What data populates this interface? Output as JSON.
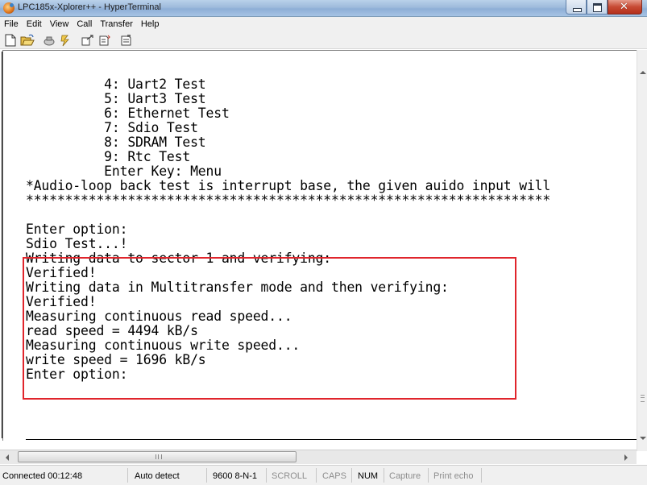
{
  "window": {
    "title": "LPC185x-Xplorer++ - HyperTerminal"
  },
  "menu": [
    "File",
    "Edit",
    "View",
    "Call",
    "Transfer",
    "Help"
  ],
  "toolbar": {
    "icons": [
      "new-icon",
      "open-icon",
      "call-icon",
      "hang-up-icon",
      "send-icon",
      "receive-icon",
      "properties-icon"
    ]
  },
  "terminal": {
    "lines": [
      "          4: Uart2 Test",
      "          5: Uart3 Test",
      "          6: Ethernet Test",
      "          7: Sdio Test",
      "          8: SDRAM Test",
      "          9: Rtc Test",
      "          Enter Key: Menu",
      "*Audio-loop back test is interrupt base, the given auido input will",
      "*******************************************************************",
      "",
      "Enter option:",
      "Sdio Test...!",
      "Writing data to sector 1 and verifying:",
      "Verified!",
      "Writing data in Multitransfer mode and then verifying:",
      "Verified!",
      "Measuring continuous read speed...",
      "read speed = 4494 kB/s",
      "Measuring continuous write speed...",
      "write speed = 1696 kB/s",
      "Enter option:"
    ],
    "highlight_color": "#e0252c"
  },
  "statusbar": {
    "connected": "Connected 00:12:48",
    "detect": "Auto detect",
    "settings": "9600 8-N-1",
    "scroll": "SCROLL",
    "caps": "CAPS",
    "num": "NUM",
    "capture": "Capture",
    "print_echo": "Print echo"
  }
}
